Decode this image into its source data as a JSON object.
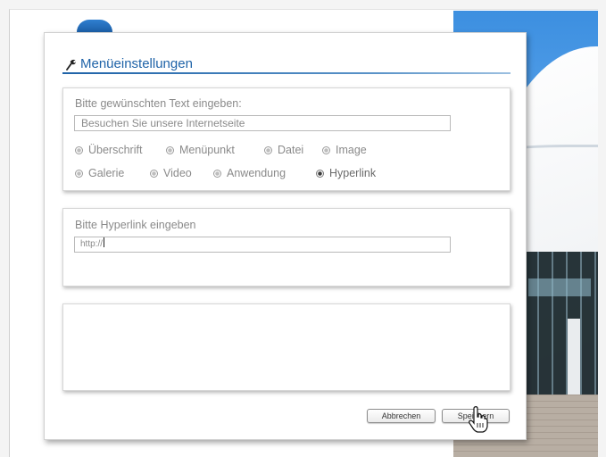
{
  "dialog": {
    "title": "Menüeinstellungen",
    "icon": "wrench-icon",
    "text_section": {
      "label": "Bitte gewünschten Text eingeben:",
      "input_value": "Besuchen Sie unsere Internetseite"
    },
    "type_options": [
      {
        "label": "Überschrift",
        "selected": false
      },
      {
        "label": "Menüpunkt",
        "selected": false
      },
      {
        "label": "Datei",
        "selected": false
      },
      {
        "label": "Image",
        "selected": false
      },
      {
        "label": "Galerie",
        "selected": false
      },
      {
        "label": "Video",
        "selected": false
      },
      {
        "label": "Anwendung",
        "selected": false
      },
      {
        "label": "Hyperlink",
        "selected": true
      }
    ],
    "link_section": {
      "label": "Bitte Hyperlink eingeben",
      "input_value": "http://"
    },
    "buttons": {
      "cancel_label": "Abbrechen",
      "save_label": "Speichern"
    }
  },
  "colors": {
    "accent": "#1f63a8",
    "muted_text": "#8a8a8a"
  }
}
